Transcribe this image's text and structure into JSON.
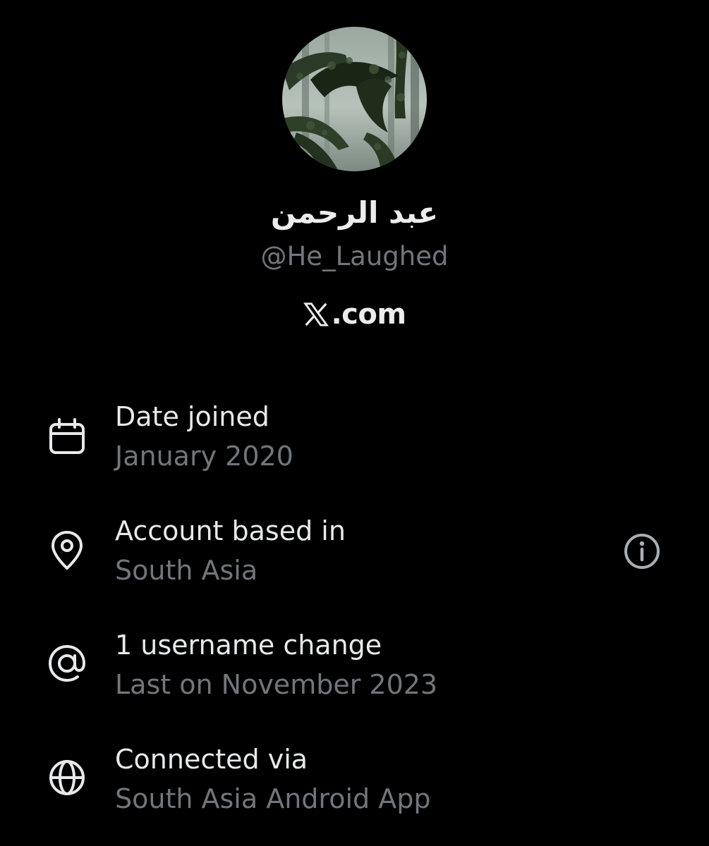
{
  "profile": {
    "avatar_icon": "forest-profile-photo",
    "display_name": "عبد الرحمن",
    "handle": "@He_Laughed",
    "site_logo_icon": "x-logo-icon",
    "site_text": ".com"
  },
  "details": [
    {
      "icon": "calendar-icon",
      "title": "Date joined",
      "subtitle": "January 2020"
    },
    {
      "icon": "location-pin-icon",
      "title": "Account based in",
      "subtitle": "South Asia",
      "action_icon": "info-icon"
    },
    {
      "icon": "at-sign-icon",
      "title": "1 username change",
      "subtitle": "Last on November 2023"
    },
    {
      "icon": "globe-icon",
      "title": "Connected via",
      "subtitle": "South Asia Android App"
    }
  ],
  "colors": {
    "background": "#000000",
    "primary_text": "#e7e9ea",
    "secondary_text": "#71767b",
    "icon": "#e7e9ea"
  }
}
